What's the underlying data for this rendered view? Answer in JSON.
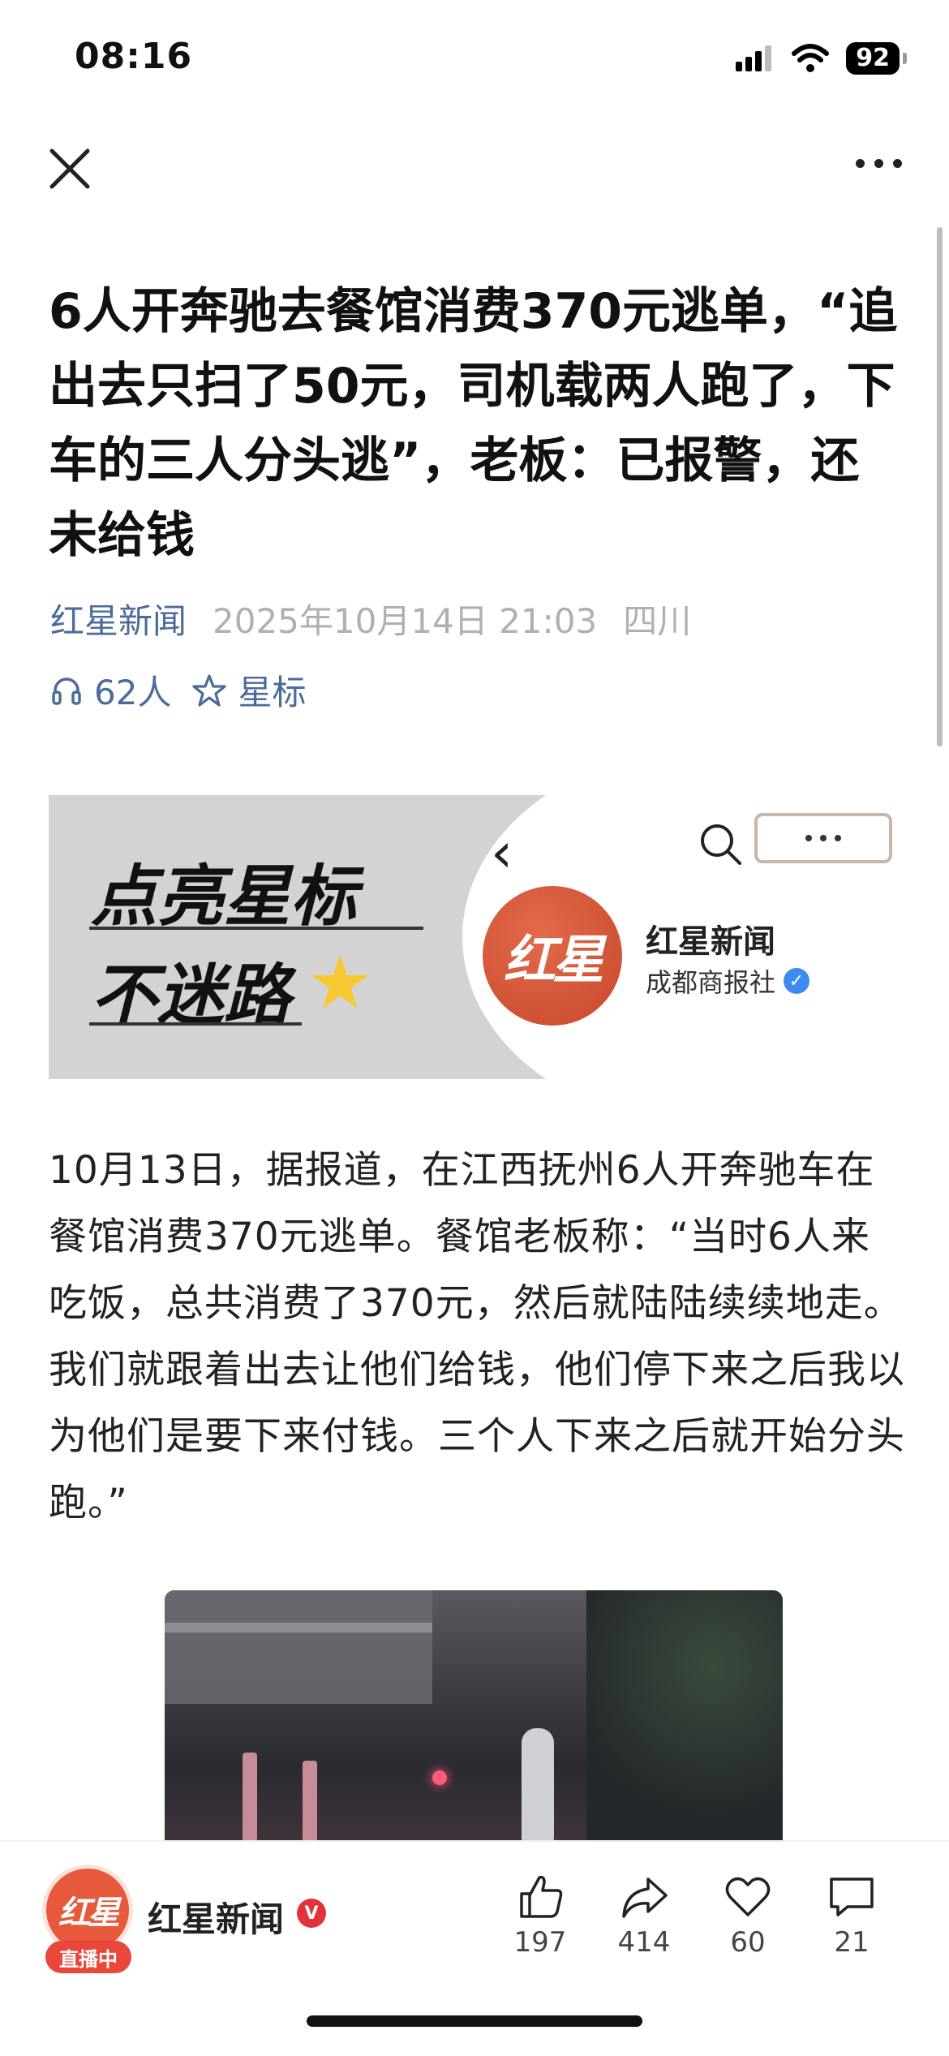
{
  "status_bar": {
    "time": "08:16",
    "battery": "92"
  },
  "nav": {
    "close_icon": "close-icon",
    "more_icon": "more-icon"
  },
  "article": {
    "title": "6人开奔驰去餐馆消费370元逃单，“追出去只扫了50元，司机载两人跑了，下车的三人分头逃”，老板：已报警，还未给钱",
    "source": "红星新闻",
    "datetime": "2025年10月14日 21:03",
    "location": "四川",
    "listeners": "62人",
    "star_label": "星标",
    "body": "10月13日，据报道，在江西抚州6人开奔驰车在餐馆消费370元逃单。餐馆老板称：“当时6人来吃饭，总共消费了370元，然后就陆陆续续地走。我们就跟着出去让他们给钱，他们停下来之后我以为他们是要下来付钱。三个人下来之后就开始分头跑。”"
  },
  "banner": {
    "slogan_line1": "点亮星标",
    "slogan_line2": "不迷路",
    "logo_text": "红星",
    "account_name": "红星新闻",
    "account_org": "成都商报社"
  },
  "bottom_bar": {
    "avatar_text": "红星",
    "live_badge": "直播中",
    "account_name": "红星新闻",
    "verified_mark": "V",
    "likes": "197",
    "shares": "414",
    "favorites": "60",
    "comments": "21"
  },
  "colors": {
    "source_blue": "#4c6b9a",
    "brand_red": "#e65a3b",
    "star_yellow": "#f6c933"
  }
}
